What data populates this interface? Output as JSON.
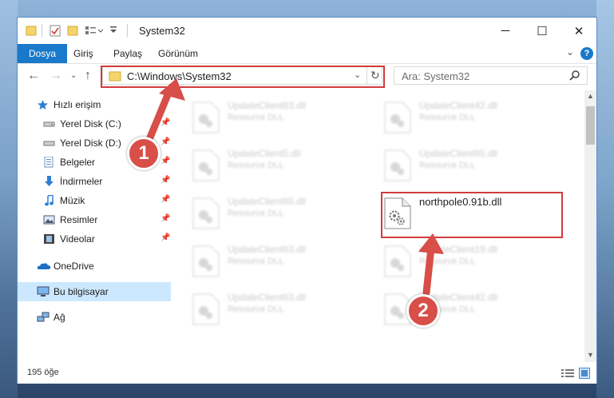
{
  "window": {
    "title": "System32",
    "controls": {
      "minimize": "─",
      "maximize": "☐",
      "close": "✕"
    }
  },
  "ribbon": {
    "tabs": [
      {
        "label": "Dosya",
        "active": true
      },
      {
        "label": "Giriş"
      },
      {
        "label": "Paylaş"
      },
      {
        "label": "Görünüm"
      }
    ],
    "help": "?"
  },
  "navigation": {
    "address": "C:\\Windows\\System32",
    "search_placeholder": "Ara: System32"
  },
  "sidebar": {
    "items": [
      {
        "label": "Hızlı erişim",
        "icon": "star-icon"
      },
      {
        "label": "Yerel Disk (C:)",
        "icon": "drive-icon",
        "pinned": true
      },
      {
        "label": "Yerel Disk (D:)",
        "icon": "drive-icon",
        "pinned": true
      },
      {
        "label": "Belgeler",
        "icon": "documents-icon",
        "pinned": true
      },
      {
        "label": "İndirmeler",
        "icon": "download-icon",
        "pinned": true
      },
      {
        "label": "Müzik",
        "icon": "music-icon",
        "pinned": true
      },
      {
        "label": "Resimler",
        "icon": "pictures-icon",
        "pinned": true
      },
      {
        "label": "Videolar",
        "icon": "videos-icon",
        "pinned": true
      },
      {
        "label": "OneDrive",
        "icon": "onedrive-icon"
      },
      {
        "label": "Bu bilgisayar",
        "icon": "computer-icon",
        "selected": true
      },
      {
        "label": "Ağ",
        "icon": "network-icon"
      }
    ]
  },
  "files": {
    "left_column": [
      {
        "name": "UpdateClient63.dll",
        "type": "Resource DLL"
      },
      {
        "name": "UpdateClient5.dll",
        "type": "Resource DLL"
      },
      {
        "name": "UpdateClient65.dll",
        "type": "Resource DLL"
      },
      {
        "name": "UpdateClient63.dll",
        "type": "Resource DLL"
      },
      {
        "name": "UpdateClient63.dll",
        "type": "Resource DLL"
      }
    ],
    "right_column": [
      {
        "name": "UpdateClient42.dll",
        "type": "Resource DLL"
      },
      {
        "name": "UpdateClient65.dll",
        "type": "Resource DLL"
      },
      {
        "name": "northpole0.91b.dll",
        "type": "",
        "highlighted": true
      },
      {
        "name": "UpdateClient19.dll",
        "type": "Resource DLL"
      },
      {
        "name": "UpdateClient42.dll",
        "type": "Resource DLL"
      }
    ]
  },
  "status": {
    "item_count": "195 öğe"
  },
  "annotations": {
    "step1": "1",
    "step2": "2",
    "highlight_color": "#d23b3b"
  }
}
